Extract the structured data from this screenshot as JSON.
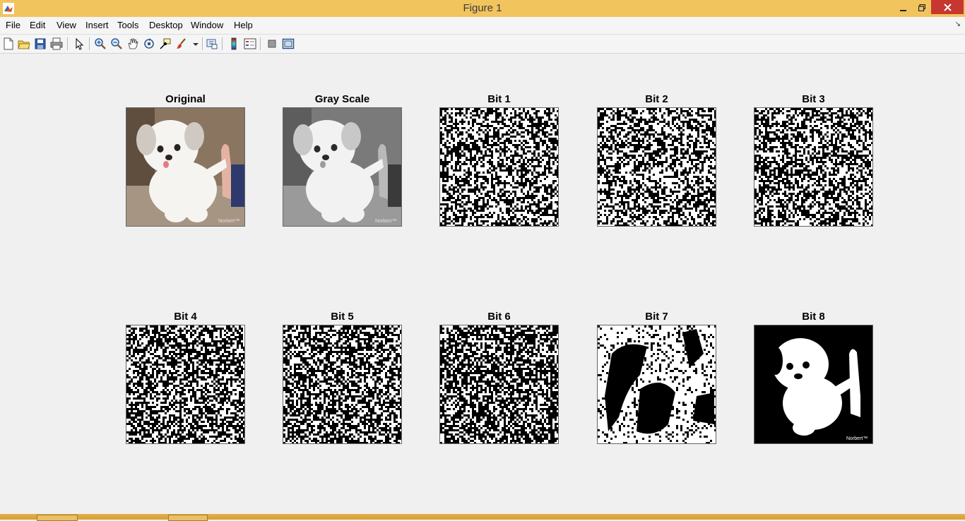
{
  "window": {
    "title": "Figure 1",
    "accent_color": "#f1c45e",
    "close_color": "#c7372f",
    "minimize_icon": "minimize-icon",
    "restore_icon": "restore-icon",
    "close_icon": "close-icon"
  },
  "menu": {
    "items": [
      {
        "label": "File",
        "mnemonic": "F"
      },
      {
        "label": "Edit",
        "mnemonic": "E"
      },
      {
        "label": "View",
        "mnemonic": "V"
      },
      {
        "label": "Insert",
        "mnemonic": "I"
      },
      {
        "label": "Tools",
        "mnemonic": "T"
      },
      {
        "label": "Desktop",
        "mnemonic": "D"
      },
      {
        "label": "Window",
        "mnemonic": "W"
      },
      {
        "label": "Help",
        "mnemonic": "H"
      }
    ]
  },
  "toolbar": {
    "icons": [
      "new-figure-icon",
      "open-file-icon",
      "save-figure-icon",
      "print-figure-icon",
      "edit-plot-icon",
      "zoom-in-icon",
      "zoom-out-icon",
      "pan-icon",
      "rotate-3d-icon",
      "data-cursor-icon",
      "brush-icon",
      "link-plot-icon",
      "insert-colorbar-icon",
      "insert-legend-icon",
      "hide-plot-tools-icon",
      "show-plot-tools-icon"
    ]
  },
  "subplots": [
    {
      "title": "Original",
      "kind": "photo"
    },
    {
      "title": "Gray Scale",
      "kind": "gray"
    },
    {
      "title": "Bit 1",
      "kind": "noise"
    },
    {
      "title": "Bit 2",
      "kind": "noise"
    },
    {
      "title": "Bit 3",
      "kind": "noise"
    },
    {
      "title": "Bit 4",
      "kind": "noise"
    },
    {
      "title": "Bit 5",
      "kind": "noise"
    },
    {
      "title": "Bit 6",
      "kind": "noise"
    },
    {
      "title": "Bit 7",
      "kind": "binary"
    },
    {
      "title": "Bit 8",
      "kind": "binary"
    }
  ]
}
